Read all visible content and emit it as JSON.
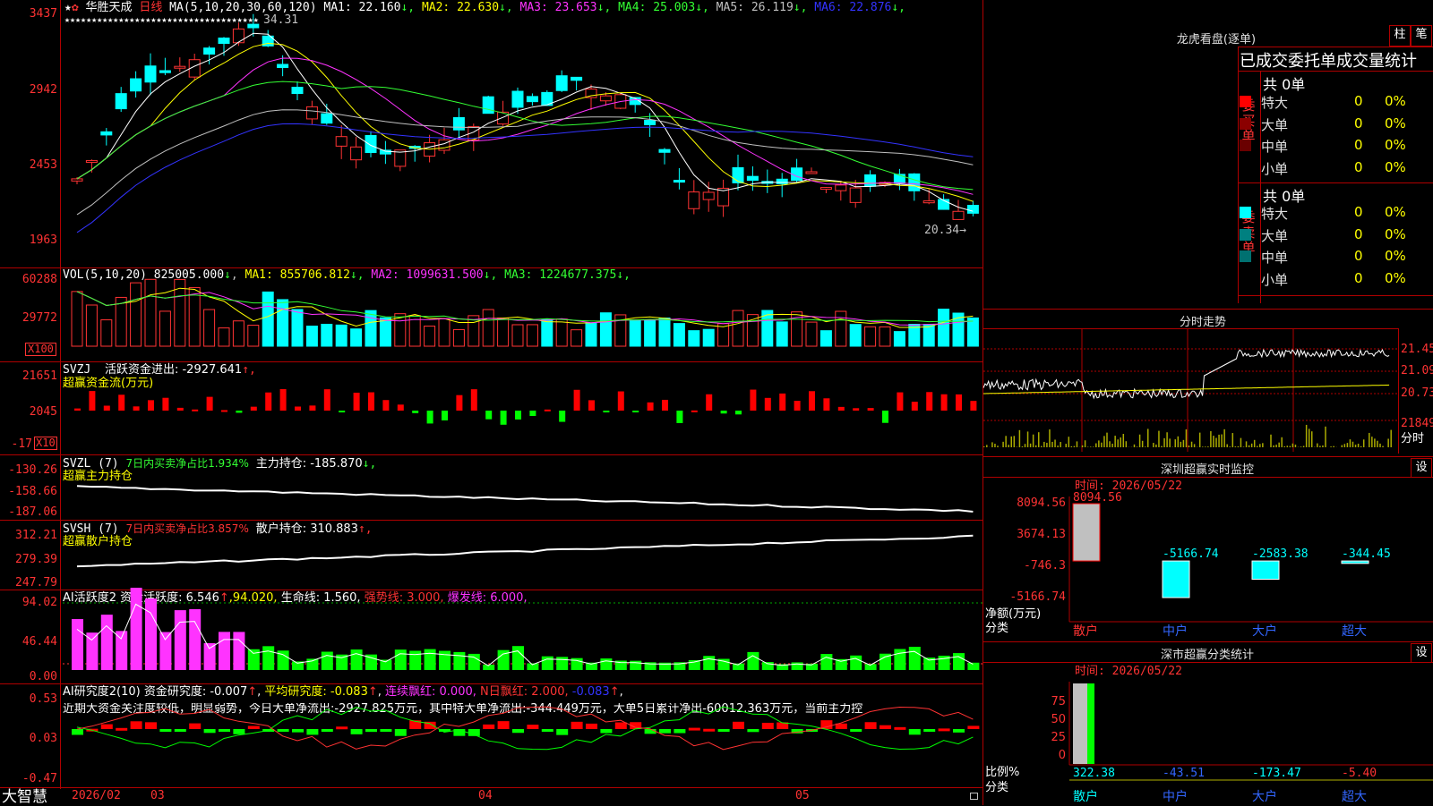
{
  "stock": {
    "name": "华胜天成",
    "period": "日线",
    "ma_label": "MA(5,10,20,30,60,120)",
    "ma": [
      {
        "label": "MA1:",
        "value": "22.160",
        "arrow": "↓",
        "color": "#ffffff"
      },
      {
        "label": "MA2:",
        "value": "22.630",
        "arrow": "↓",
        "color": "#ffff00"
      },
      {
        "label": "MA3:",
        "value": "23.653",
        "arrow": "↓",
        "color": "#ff33ff"
      },
      {
        "label": "MA4:",
        "value": "25.003",
        "arrow": "↓",
        "color": "#33ff33"
      },
      {
        "label": "MA5:",
        "value": "26.119",
        "arrow": "↓",
        "color": "#c0c0c0"
      },
      {
        "label": "MA6:",
        "value": "22.876",
        "arrow": "↓",
        "color": "#3333ff"
      }
    ],
    "price_ticks": [
      "3437",
      "2942",
      "2453",
      "1963"
    ],
    "high_label": "34.31",
    "low_label": "20.34→"
  },
  "vol": {
    "label": "VOL(5,10,20)",
    "value": "825005.000",
    "arrow": "↓",
    "ma": [
      {
        "label": "MA1:",
        "value": "855706.812",
        "arrow": "↓",
        "color": "#ffff00"
      },
      {
        "label": "MA2:",
        "value": "1099631.500",
        "arrow": "↓",
        "color": "#ff33ff"
      },
      {
        "label": "MA3:",
        "value": "1224677.375",
        "arrow": "↓",
        "color": "#33ff33"
      }
    ],
    "ticks": [
      "60288",
      "29772"
    ],
    "unit": "X100"
  },
  "svzj": {
    "label": "SVZJ",
    "text": "活跃资金进出: -2927.641",
    "arrow": "↑,",
    "subtitle": "超赢资金流(万元)",
    "ticks": [
      "21651",
      "2045",
      "-17"
    ],
    "unit": "X10"
  },
  "svzl": {
    "label": "SVZL (7)",
    "text1": "7日内买卖净占比1.934%",
    "text2": "主力持仓: -185.870",
    "arrow": "↓,",
    "subtitle": "超赢主力持仓",
    "ticks": [
      "-130.26",
      "-158.66",
      "-187.06"
    ]
  },
  "svsh": {
    "label": "SVSH (7)",
    "text1": "7日内买卖净占比3.857%",
    "text2": "散户持仓: 310.883",
    "arrow": "↑,",
    "subtitle": "超赢散户持仓",
    "ticks": [
      "312.21",
      "279.39",
      "247.79"
    ]
  },
  "ai1": {
    "label": "AI活跃度2",
    "t1": "资金活跃度: 6.546",
    "a1": "↑",
    "t2": ",94.020,",
    "t3": "生命线: 1.560,",
    "t4": "强势线: 3.000,",
    "t5": "爆发线: 6.000,",
    "ticks": [
      "94.02",
      "46.44",
      "0.00"
    ]
  },
  "ai2": {
    "label": "AI研究度2(10)",
    "t1": "资金研究度: -0.007",
    "t2": "平均研究度: -0.083",
    "t3": "连续飘红: 0.000,",
    "t4": "N日飘红: 2.000,",
    "t5": "-0.083",
    "arrow": "↑",
    "comment": "近期大资金关注度较低，明显弱势，今日大单净流出:-2927.825万元，其中特大单净流出:-344.449万元，大单5日累计净出-60012.363万元，当前主力控",
    "ticks": [
      "0.53",
      "0.03",
      "-0.47"
    ]
  },
  "axis": {
    "brand": "大智慧",
    "labels": [
      "2026/02",
      "03",
      "04",
      "05"
    ]
  },
  "lhb": {
    "title": "龙虎看盘(逐单)",
    "btn_bar": "柱",
    "btn_pen": "笔",
    "header": "已成交委托单成交量统计",
    "buy_title": "共 0单",
    "buy_side": "委买单",
    "sell_title": "共 0单",
    "sell_side": "委卖单",
    "buy_rows": [
      {
        "name": "特大",
        "n": "0",
        "pct": "0%",
        "color": "#ff0000"
      },
      {
        "name": "大单",
        "n": "0",
        "pct": "0%",
        "color": "#8b0000"
      },
      {
        "name": "中单",
        "n": "0",
        "pct": "0%",
        "color": "#6a0000"
      },
      {
        "name": "小单",
        "n": "0",
        "pct": "0%",
        "color": "#000000"
      }
    ],
    "sell_rows": [
      {
        "name": "特大",
        "n": "0",
        "pct": "0%",
        "color": "#00ffff"
      },
      {
        "name": "大单",
        "n": "0",
        "pct": "0%",
        "color": "#008080"
      },
      {
        "name": "中单",
        "n": "0",
        "pct": "0%",
        "color": "#007070"
      },
      {
        "name": "小单",
        "n": "0",
        "pct": "0%",
        "color": "#000000"
      }
    ]
  },
  "intraday": {
    "title": "分时走势",
    "ticks": [
      "21.45",
      "21.09",
      "20.73",
      "21849"
    ],
    "unit": "分时"
  },
  "monitor": {
    "title": "深圳超赢实时监控",
    "btn": "设",
    "time": "时间: 2026/05/22",
    "ticks": [
      "8094.56",
      "3674.13",
      "-746.3",
      "-5166.74"
    ],
    "ylabel1": "净额(万元)",
    "ylabel2": "分类",
    "categories": [
      "散户",
      "中户",
      "大户",
      "超大"
    ],
    "values": [
      8094.56,
      -5166.74,
      -2583.38,
      -344.45
    ],
    "value_labels": [
      "8094.56",
      "-5166.74",
      "-2583.38",
      "-344.45"
    ]
  },
  "classify": {
    "title": "深市超赢分类统计",
    "btn": "设",
    "time": "时间: 2026/05/22",
    "ticks": [
      "75",
      "50",
      "25",
      "0"
    ],
    "ylabel1": "比例%",
    "ylabel2": "分类",
    "categories": [
      "散户",
      "中户",
      "大户",
      "超大"
    ],
    "value_labels": [
      "322.38",
      "-43.51",
      "-173.47",
      "-5.40"
    ]
  }
}
